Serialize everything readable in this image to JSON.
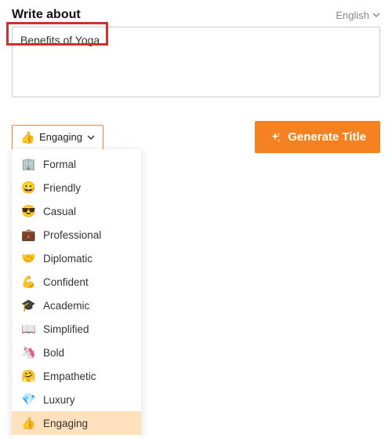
{
  "header": {
    "label": "Write about",
    "language": "English"
  },
  "input": {
    "value": "Benefits of Yoga"
  },
  "tone_selector": {
    "current_emoji": "👍",
    "current_label": "Engaging"
  },
  "generate_button": {
    "label": "Generate Title"
  },
  "tone_options": [
    {
      "emoji": "🏢",
      "label": "Formal",
      "selected": false
    },
    {
      "emoji": "😀",
      "label": "Friendly",
      "selected": false
    },
    {
      "emoji": "😎",
      "label": "Casual",
      "selected": false
    },
    {
      "emoji": "💼",
      "label": "Professional",
      "selected": false
    },
    {
      "emoji": "🤝",
      "label": "Diplomatic",
      "selected": false
    },
    {
      "emoji": "💪",
      "label": "Confident",
      "selected": false
    },
    {
      "emoji": "🎓",
      "label": "Academic",
      "selected": false
    },
    {
      "emoji": "📖",
      "label": "Simplified",
      "selected": false
    },
    {
      "emoji": "🦄",
      "label": "Bold",
      "selected": false
    },
    {
      "emoji": "🤗",
      "label": "Empathetic",
      "selected": false
    },
    {
      "emoji": "💎",
      "label": "Luxury",
      "selected": false
    },
    {
      "emoji": "👍",
      "label": "Engaging",
      "selected": true
    }
  ]
}
